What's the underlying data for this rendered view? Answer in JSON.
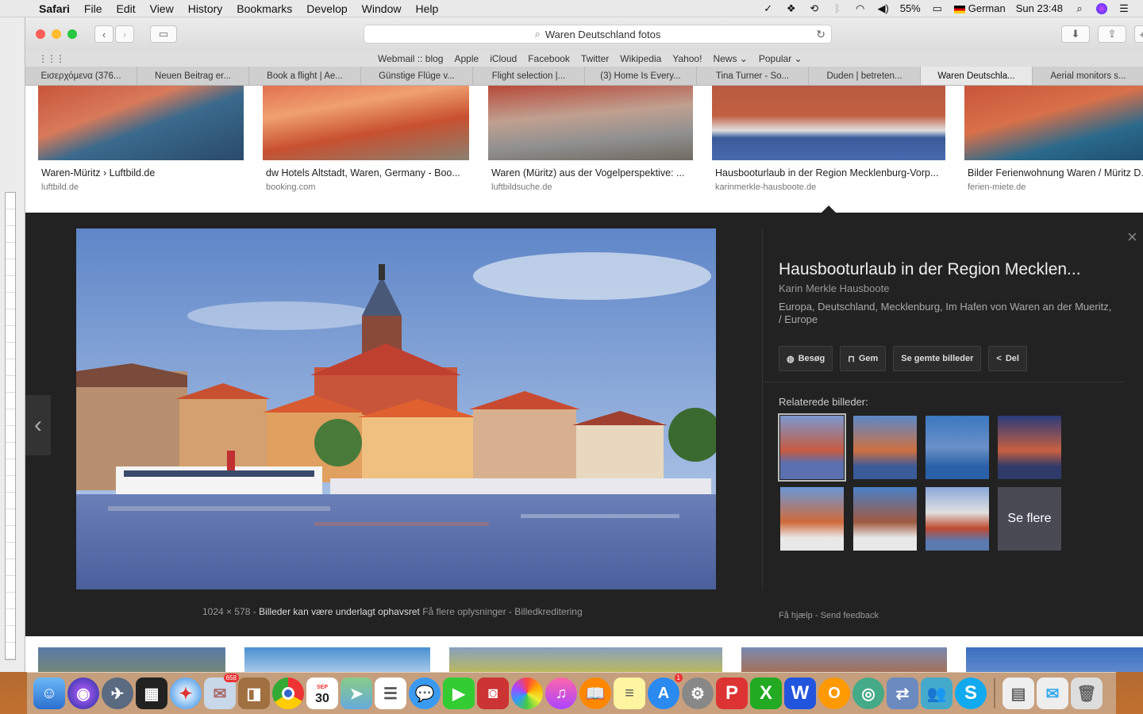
{
  "menubar": {
    "app": "Safari",
    "items": [
      "File",
      "Edit",
      "View",
      "History",
      "Bookmarks",
      "Develop",
      "Window",
      "Help"
    ],
    "battery": "55%",
    "input_language": "German",
    "clock": "Sun 23:48"
  },
  "browser": {
    "url_text": "Waren Deutschland fotos",
    "favorites": [
      "Webmail :: blog",
      "Apple",
      "iCloud",
      "Facebook",
      "Twitter",
      "Wikipedia",
      "Yahoo!",
      "News ⌄",
      "Popular ⌄"
    ],
    "tabs": [
      "Εισερχόμενα (376...",
      "Neuen Beitrag er...",
      "Book a flight | Ae...",
      "Günstige Flüge v...",
      "Flight selection |...",
      "(3) Home Is Every...",
      "Tina Turner - So...",
      "Duden | betreten...",
      "Waren Deutschla...",
      "Aerial monitors s..."
    ],
    "active_tab": 8
  },
  "results": [
    {
      "title": "Waren-Müritz › Luftbild.de",
      "domain": "luftbild.de"
    },
    {
      "title": "dw Hotels Altstadt, Waren, Germany - Boo...",
      "domain": "booking.com"
    },
    {
      "title": "Waren (Müritz) aus der Vogelperspektive: ...",
      "domain": "luftbildsuche.de"
    },
    {
      "title": "Hausbooturlaub in der Region Mecklenburg-Vorp...",
      "domain": "karinmerkle-hausboote.de"
    },
    {
      "title": "Bilder Ferienwohnung Waren / Müritz D...",
      "domain": "ferien-miete.de"
    }
  ],
  "viewer": {
    "title": "Hausbooturlaub in der Region Mecklen...",
    "source": "Karin Merkle Hausboote",
    "description": "Europa, Deutschland, Mecklenburg, Im Hafen von Waren an der Mueritz, / Europe",
    "buttons": [
      "Besøg",
      "Gem",
      "Se gemte billeder",
      "Del"
    ],
    "related_header": "Relaterede billeder:",
    "more_label": "Se flere",
    "size": "1024 × 578",
    "rights": "Billeder kan være underlagt ophavsret",
    "more_info": "Få flere oplysninger",
    "credits": "Billedkreditering",
    "help": "Få hjælp",
    "feedback": "Send feedback"
  },
  "dock": {
    "mail_badge": "658",
    "calendar_day": "30",
    "calendar_month": "SEP",
    "appstore_badge": "1"
  }
}
